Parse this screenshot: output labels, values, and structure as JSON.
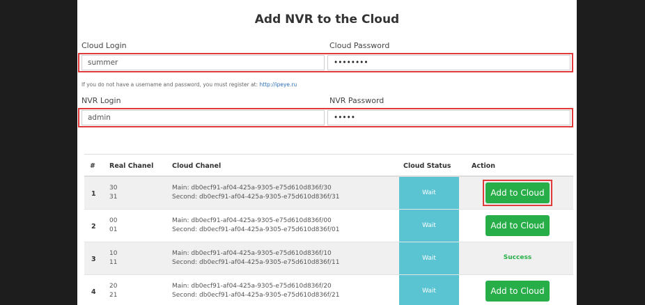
{
  "page": {
    "title": "Add NVR to the Cloud",
    "cloud_login_label": "Cloud Login",
    "cloud_password_label": "Cloud Password",
    "cloud_login_value": "summer",
    "cloud_password_value": "••••••••",
    "register_note": "If you do not have a username and password, you must register at:",
    "register_link": "http://ipeye.ru",
    "nvr_login_label": "NVR Login",
    "nvr_password_label": "NVR Password",
    "nvr_login_value": "admin",
    "nvr_password_value": "•••••"
  },
  "table": {
    "headers": [
      "#",
      "Real Chanel",
      "Cloud Chanel",
      "Cloud Status",
      "Action"
    ],
    "rows": [
      {
        "num": "1",
        "real_main": "30",
        "real_second": "31",
        "cloud_main": "Main: db0ecf91-af04-425a-9305-e75d610d836f/30",
        "cloud_second": "Second: db0ecf91-af04-425a-9305-e75d610d836f/31",
        "status": "Wait",
        "action": "Add to Cloud"
      },
      {
        "num": "2",
        "real_main": "00",
        "real_second": "01",
        "cloud_main": "Main: db0ecf91-af04-425a-9305-e75d610d836f/00",
        "cloud_second": "Second: db0ecf91-af04-425a-9305-e75d610d836f/01",
        "status": "Wait",
        "action": "Add to Cloud"
      },
      {
        "num": "3",
        "real_main": "10",
        "real_second": "11",
        "cloud_main": "Main: db0ecf91-af04-425a-9305-e75d610d836f/10",
        "cloud_second": "Second: db0ecf91-af04-425a-9305-e75d610d836f/11",
        "status": "Wait",
        "action": "Success"
      },
      {
        "num": "4",
        "real_main": "20",
        "real_second": "21",
        "cloud_main": "Main: db0ecf91-af04-425a-9305-e75d610d836f/20",
        "cloud_second": "Second: db0ecf91-af04-425a-9305-e75d610d836f/21",
        "status": "Wait",
        "action": "Add to Cloud"
      }
    ]
  },
  "colors": {
    "status_bg": "#5ac4d3",
    "button_bg": "#27ae48",
    "highlight": "#e03a3a",
    "success_text": "#27ae48"
  }
}
